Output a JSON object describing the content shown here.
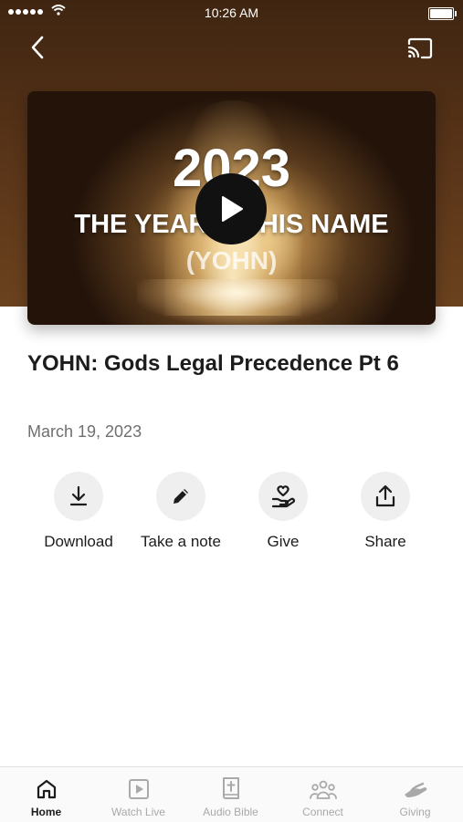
{
  "status_bar": {
    "time": "10:26 AM"
  },
  "header": {
    "back_icon": "chevron-left-icon",
    "cast_icon": "cast-icon"
  },
  "video": {
    "year": "2023",
    "line1": "THE YEAR OF HIS NAME",
    "line2": "(YOHN)",
    "play_icon": "play-icon"
  },
  "sermon": {
    "title": "YOHN: Gods Legal Precedence Pt 6",
    "date": "March 19, 2023"
  },
  "actions": [
    {
      "label": "Download",
      "icon": "download-icon"
    },
    {
      "label": "Take a note",
      "icon": "pencil-icon"
    },
    {
      "label": "Give",
      "icon": "heart-hand-icon"
    },
    {
      "label": "Share",
      "icon": "share-icon"
    }
  ],
  "tabs": [
    {
      "label": "Home",
      "icon": "home-icon",
      "active": true
    },
    {
      "label": "Watch Live",
      "icon": "play-square-icon"
    },
    {
      "label": "Audio Bible",
      "icon": "bible-icon"
    },
    {
      "label": "Connect",
      "icon": "people-icon"
    },
    {
      "label": "Giving",
      "icon": "giving-hand-icon"
    }
  ],
  "colors": {
    "header_bg": "#5a3519",
    "text": "#1c1c1c",
    "muted": "#6f6f6f",
    "tab_inactive": "#a9a9a9"
  }
}
